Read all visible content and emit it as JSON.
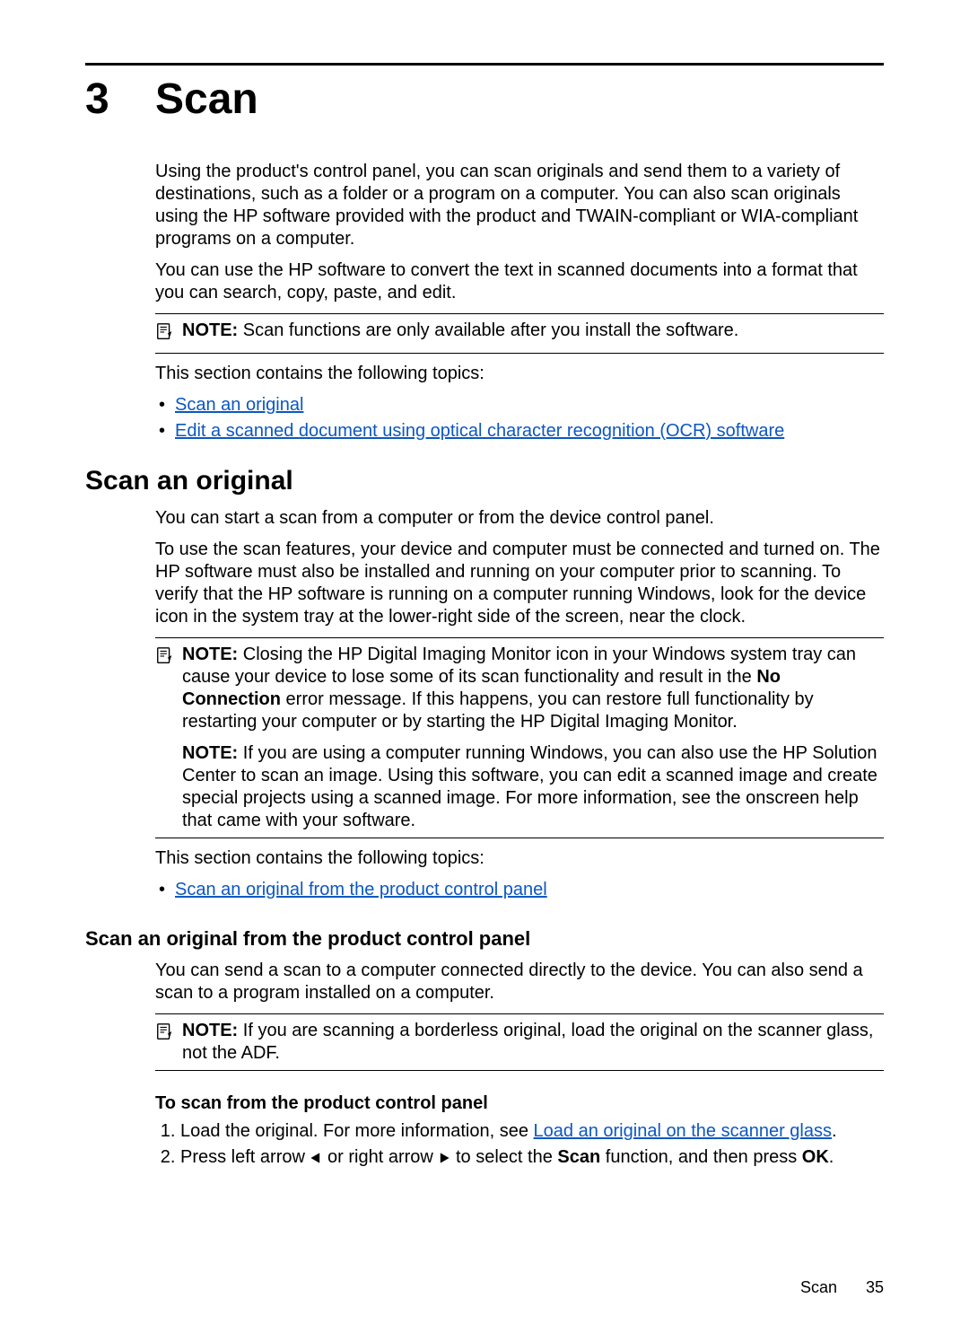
{
  "chapter": {
    "number": "3",
    "title": "Scan"
  },
  "intro": {
    "p1": "Using the product's control panel, you can scan originals and send them to a variety of destinations, such as a folder or a program on a computer. You can also scan originals using the HP software provided with the product and TWAIN-compliant or WIA-compliant programs on a computer.",
    "p2": "You can use the HP software to convert the text in scanned documents into a format that you can search, copy, paste, and edit."
  },
  "note1": {
    "label": "NOTE:",
    "text": "Scan functions are only available after you install the software."
  },
  "topics_lead": "This section contains the following topics:",
  "topics": {
    "t1": "Scan an original",
    "t2": "Edit a scanned document using optical character recognition (OCR) software"
  },
  "h2": "Scan an original",
  "s1": {
    "p1": "You can start a scan from a computer or from the device control panel.",
    "p2": "To use the scan features, your device and computer must be connected and turned on. The HP software must also be installed and running on your computer prior to scanning. To verify that the HP software is running on a computer running Windows, look for the device icon in the system tray at the lower-right side of the screen, near the clock."
  },
  "note2": {
    "label": "NOTE:",
    "p1a": "Closing the HP Digital Imaging Monitor icon in your Windows system tray can cause your device to lose some of its scan functionality and result in the ",
    "p1b": "No Connection",
    "p1c": " error message. If this happens, you can restore full functionality by restarting your computer or by starting the HP Digital Imaging Monitor.",
    "p2a": "If you are using a computer running Windows, you can also use the HP Solution Center to scan an image. Using this software, you can edit a scanned image and create special projects using a scanned image. For more information, see the onscreen help that came with your software."
  },
  "topics2_lead": "This section contains the following topics:",
  "topics2": {
    "t1": "Scan an original from the product control panel"
  },
  "h3": "Scan an original from the product control panel",
  "s2": {
    "p1": "You can send a scan to a computer connected directly to the device. You can also send a scan to a program installed on a computer."
  },
  "note3": {
    "label": "NOTE:",
    "text": "If you are scanning a borderless original, load the original on the scanner glass, not the ADF."
  },
  "h4": "To scan from the product control panel",
  "steps": {
    "s1a": "Load the original. For more information, see ",
    "s1link": "Load an original on the scanner glass",
    "s1b": ".",
    "s2a": "Press left arrow ",
    "s2b": " or right arrow ",
    "s2c": " to select the ",
    "s2d": "Scan",
    "s2e": " function, and then press ",
    "s2f": "OK",
    "s2g": "."
  },
  "footer": {
    "section": "Scan",
    "page": "35"
  }
}
